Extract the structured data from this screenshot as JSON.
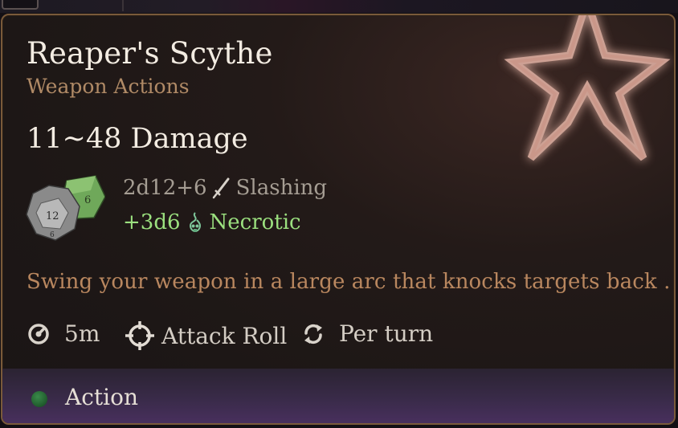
{
  "tooltip": {
    "title": "Reaper's Scythe",
    "category": "Weapon Actions",
    "damage_range": "11~48 Damage",
    "damage_lines": [
      {
        "dice": "2d12+6",
        "type": "Slashing",
        "icon": "sword-icon",
        "color": "#a59d93"
      },
      {
        "dice": "+3d6",
        "type": "Necrotic",
        "icon": "skull-icon",
        "color": "#9be07f"
      }
    ],
    "description": "Swing your weapon in a large arc that knocks targets back .",
    "properties": [
      {
        "icon": "range-icon",
        "label": "5m"
      },
      {
        "icon": "crosshair-icon",
        "label": "Attack Roll"
      },
      {
        "icon": "recharge-icon",
        "label": "Per turn"
      }
    ],
    "cost": {
      "icon": "action-dot-icon",
      "label": "Action",
      "color": "#2a7a3a"
    },
    "dice_images": {
      "d12_face": "12",
      "d12_side": "6",
      "d6_face": "6"
    }
  },
  "colors": {
    "border": "#7a5a3a",
    "title": "#f3ece2",
    "subtitle": "#b08a66",
    "description": "#b9875f",
    "necrotic": "#9be07f"
  }
}
